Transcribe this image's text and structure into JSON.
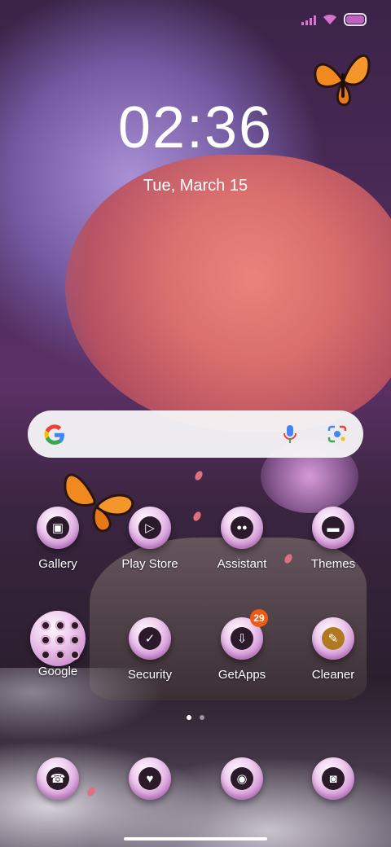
{
  "status_bar": {
    "signal_icon": "signal-bars-icon",
    "wifi_icon": "wifi-icon",
    "battery_icon": "battery-icon",
    "accent": "#d873d0"
  },
  "clock": {
    "time": "02:36",
    "date": "Tue, March 15"
  },
  "search_bar": {
    "logo_icon": "google-g-icon",
    "mic_icon": "mic-icon",
    "lens_icon": "lens-camera-icon"
  },
  "apps_row1": [
    {
      "label": "Gallery",
      "icon": "gallery-icon"
    },
    {
      "label": "Play Store",
      "icon": "play-store-icon"
    },
    {
      "label": "Assistant",
      "icon": "assistant-icon"
    },
    {
      "label": "Themes",
      "icon": "paint-roller-icon"
    }
  ],
  "apps_row2": [
    {
      "label": "Google",
      "icon": "folder-icon"
    },
    {
      "label": "Security",
      "icon": "shield-check-icon"
    },
    {
      "label": "GetApps",
      "icon": "download-cloud-icon",
      "badge": "29"
    },
    {
      "label": "Cleaner",
      "icon": "broom-icon"
    }
  ],
  "dock": [
    {
      "icon": "phone-icon"
    },
    {
      "icon": "messages-icon"
    },
    {
      "icon": "chrome-icon"
    },
    {
      "icon": "camera-icon"
    }
  ],
  "page_indicator": {
    "pages": 2,
    "current": 1
  },
  "badge_color": "#f05a12"
}
